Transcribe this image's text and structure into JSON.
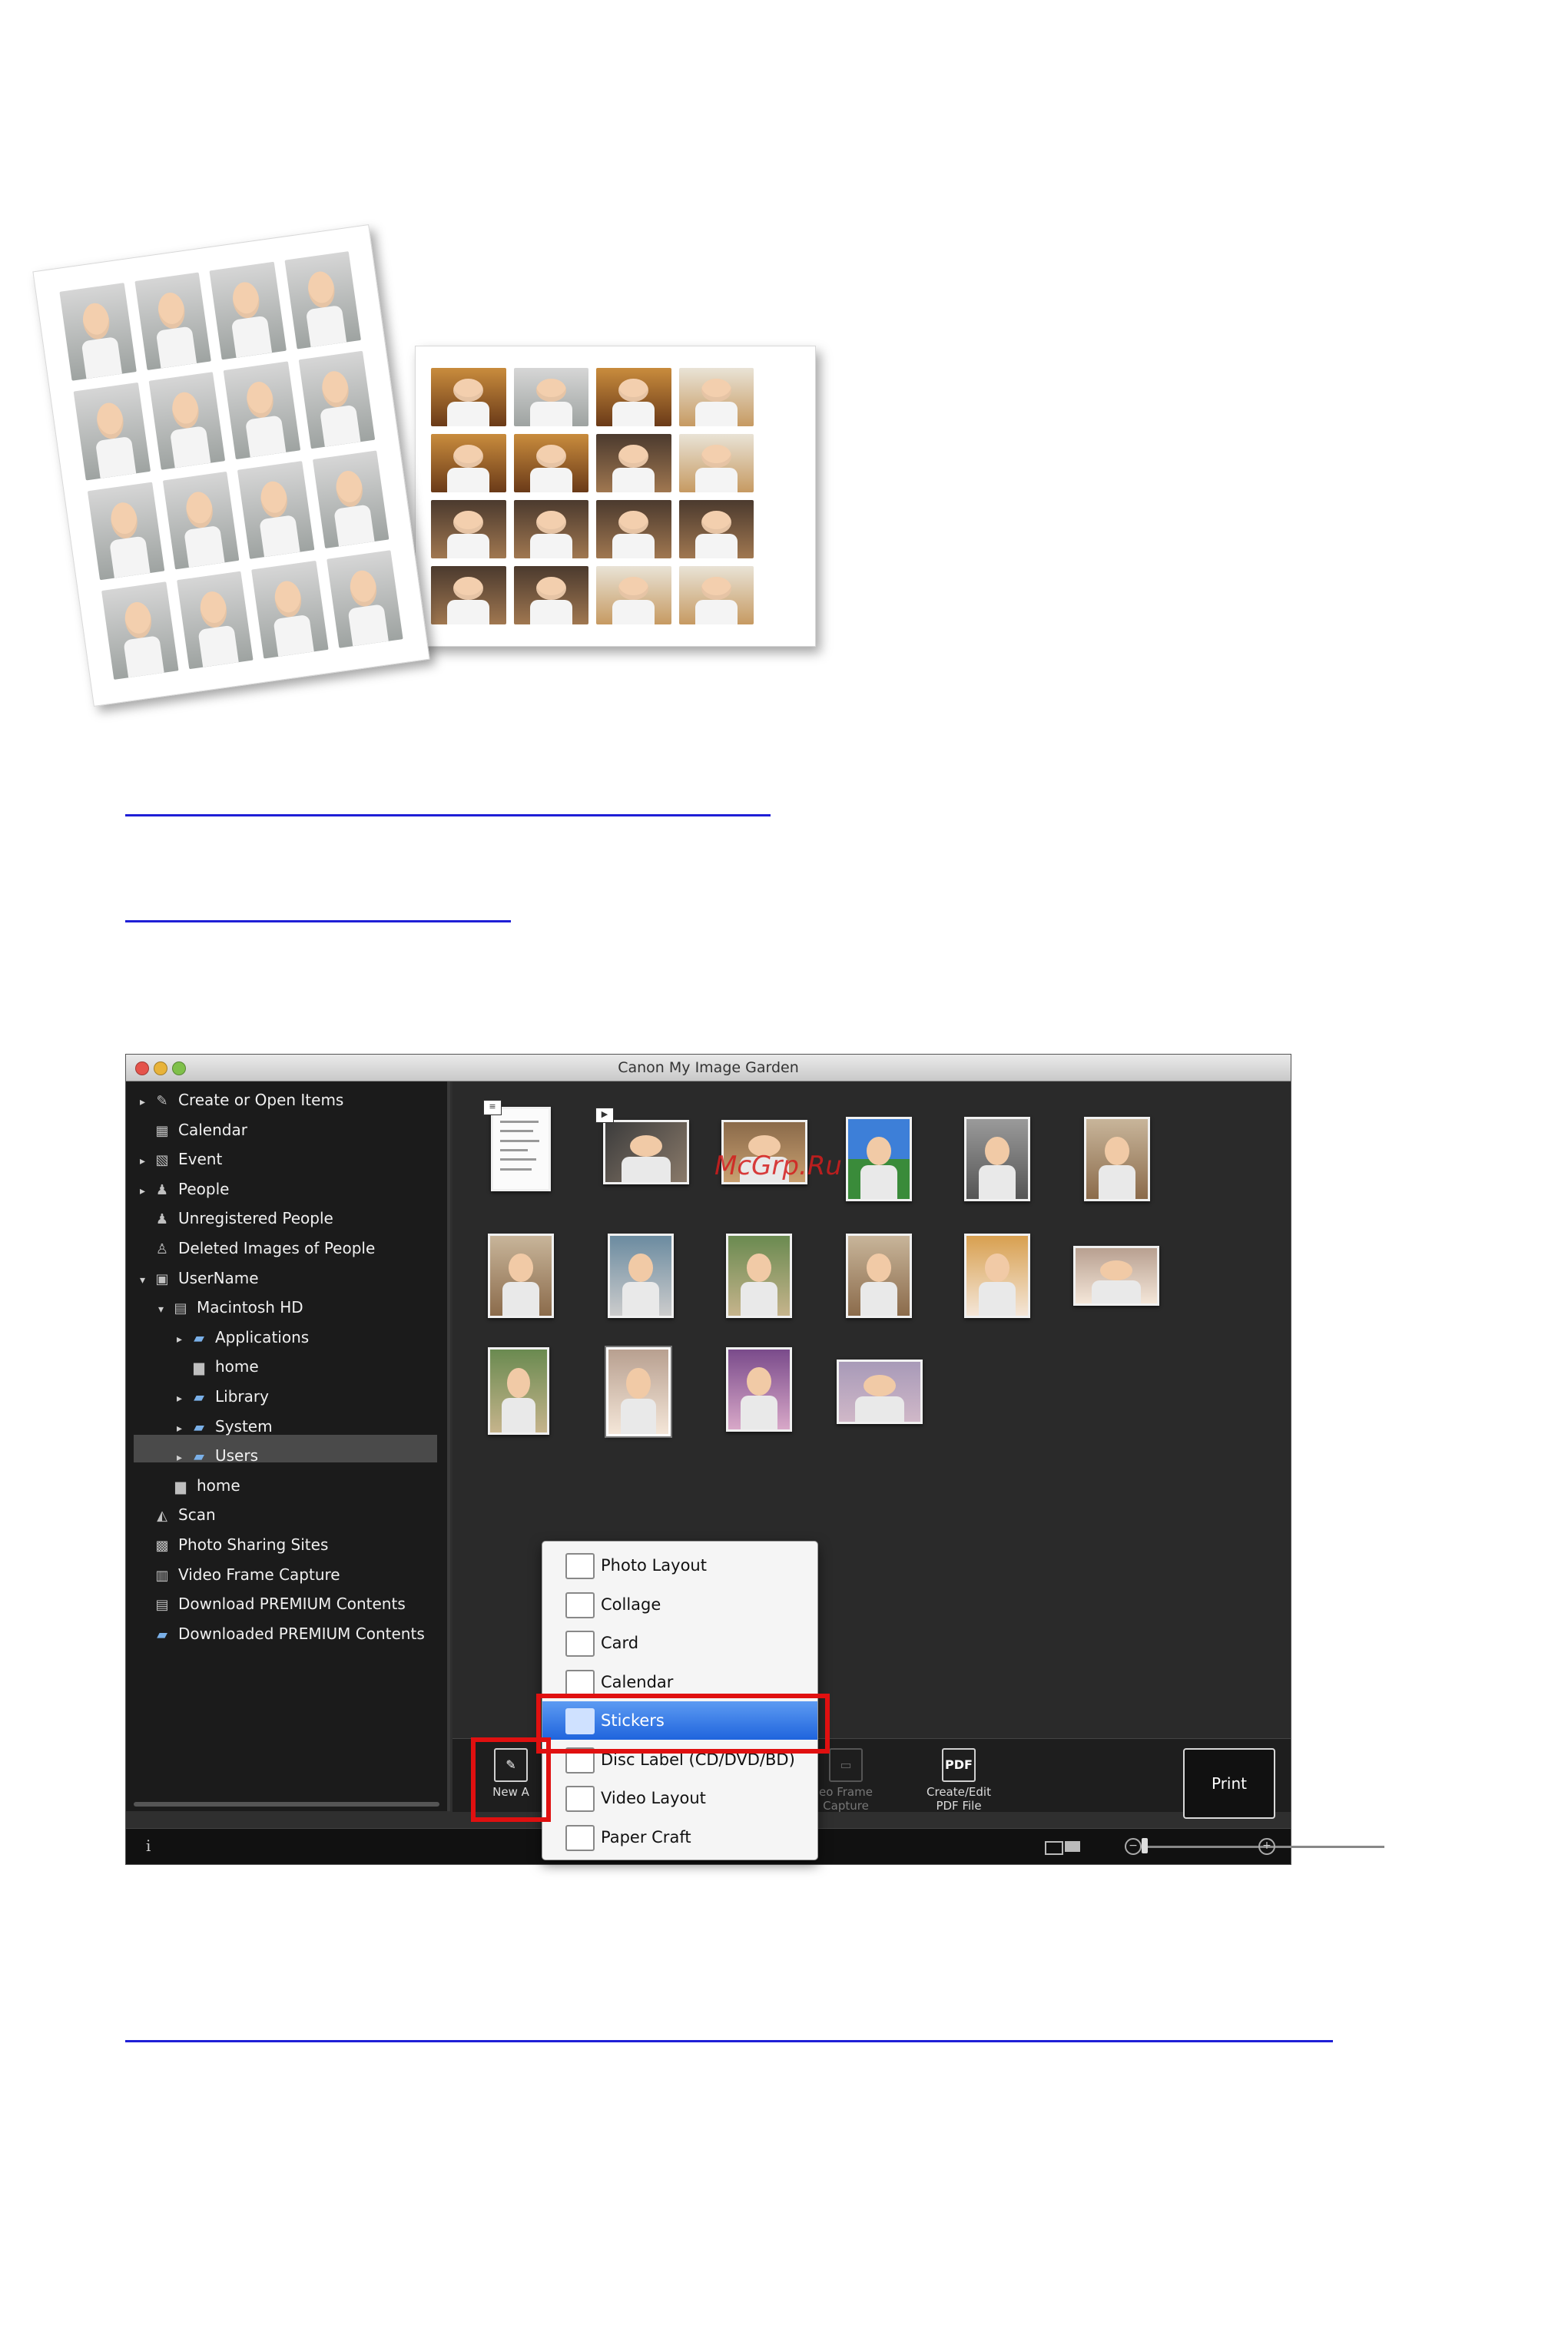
{
  "app": {
    "title": "Canon My Image Garden",
    "sidebar": {
      "items": [
        {
          "label": "Create or Open Items",
          "icon": "create-icon",
          "expander": "right",
          "depth": 0
        },
        {
          "label": "Calendar",
          "icon": "calendar-icon",
          "expander": "",
          "depth": 0
        },
        {
          "label": "Event",
          "icon": "event-icon",
          "expander": "right",
          "depth": 0
        },
        {
          "label": "People",
          "icon": "people-icon",
          "expander": "right",
          "depth": 0
        },
        {
          "label": "Unregistered People",
          "icon": "person-icon",
          "expander": "",
          "depth": 0
        },
        {
          "label": "Deleted Images of People",
          "icon": "person-outline-icon",
          "expander": "",
          "depth": 0
        },
        {
          "label": "UserName",
          "icon": "computer-icon",
          "expander": "down",
          "depth": 0
        },
        {
          "label": "Macintosh HD",
          "icon": "disk-icon",
          "expander": "down",
          "depth": 1
        },
        {
          "label": "Applications",
          "icon": "folder-icon",
          "expander": "right",
          "depth": 2
        },
        {
          "label": "home",
          "icon": "drive-icon",
          "expander": "",
          "depth": 2
        },
        {
          "label": "Library",
          "icon": "folder-icon",
          "expander": "right",
          "depth": 2
        },
        {
          "label": "System",
          "icon": "folder-icon",
          "expander": "right",
          "depth": 2
        },
        {
          "label": "Users",
          "icon": "folder-icon",
          "expander": "right",
          "depth": 2,
          "selected": true
        },
        {
          "label": "home",
          "icon": "drive-icon",
          "expander": "",
          "depth": 1
        },
        {
          "label": "Scan",
          "icon": "scan-icon",
          "expander": "",
          "depth": 0
        },
        {
          "label": "Photo Sharing Sites",
          "icon": "sharing-icon",
          "expander": "",
          "depth": 0
        },
        {
          "label": "Video Frame Capture",
          "icon": "film-icon",
          "expander": "",
          "depth": 0
        },
        {
          "label": "Download PREMIUM Contents",
          "icon": "download-icon",
          "expander": "",
          "depth": 0
        },
        {
          "label": "Downloaded PREMIUM Contents",
          "icon": "folder-icon",
          "expander": "",
          "depth": 0
        }
      ]
    },
    "toolbar": {
      "new_art_label": "New A",
      "video_frame_label": "eo Frame",
      "video_frame_label2": "Capture",
      "pdf_label": "Create/Edit",
      "pdf_label2": "PDF File",
      "pdf_icon_text": "PDF",
      "print_label": "Print"
    },
    "statusbar": {
      "info_icon": "i"
    },
    "menu": {
      "items": [
        {
          "label": "Photo Layout",
          "icon": "photo-layout-icon"
        },
        {
          "label": "Collage",
          "icon": "collage-icon"
        },
        {
          "label": "Card",
          "icon": "card-icon"
        },
        {
          "label": "Calendar",
          "icon": "calendar-layout-icon"
        },
        {
          "label": "Stickers",
          "icon": "stickers-icon",
          "highlighted": true
        },
        {
          "label": "Disc Label (CD/DVD/BD)",
          "icon": "disc-icon"
        },
        {
          "label": "Video Layout",
          "icon": "video-layout-icon"
        },
        {
          "label": "Paper Craft",
          "icon": "paper-craft-icon"
        }
      ]
    }
  },
  "watermark": "McGrp.Ru",
  "colors": {
    "highlight": "#2f74e6",
    "callout": "#e01010",
    "link": "#1f1fd6"
  }
}
